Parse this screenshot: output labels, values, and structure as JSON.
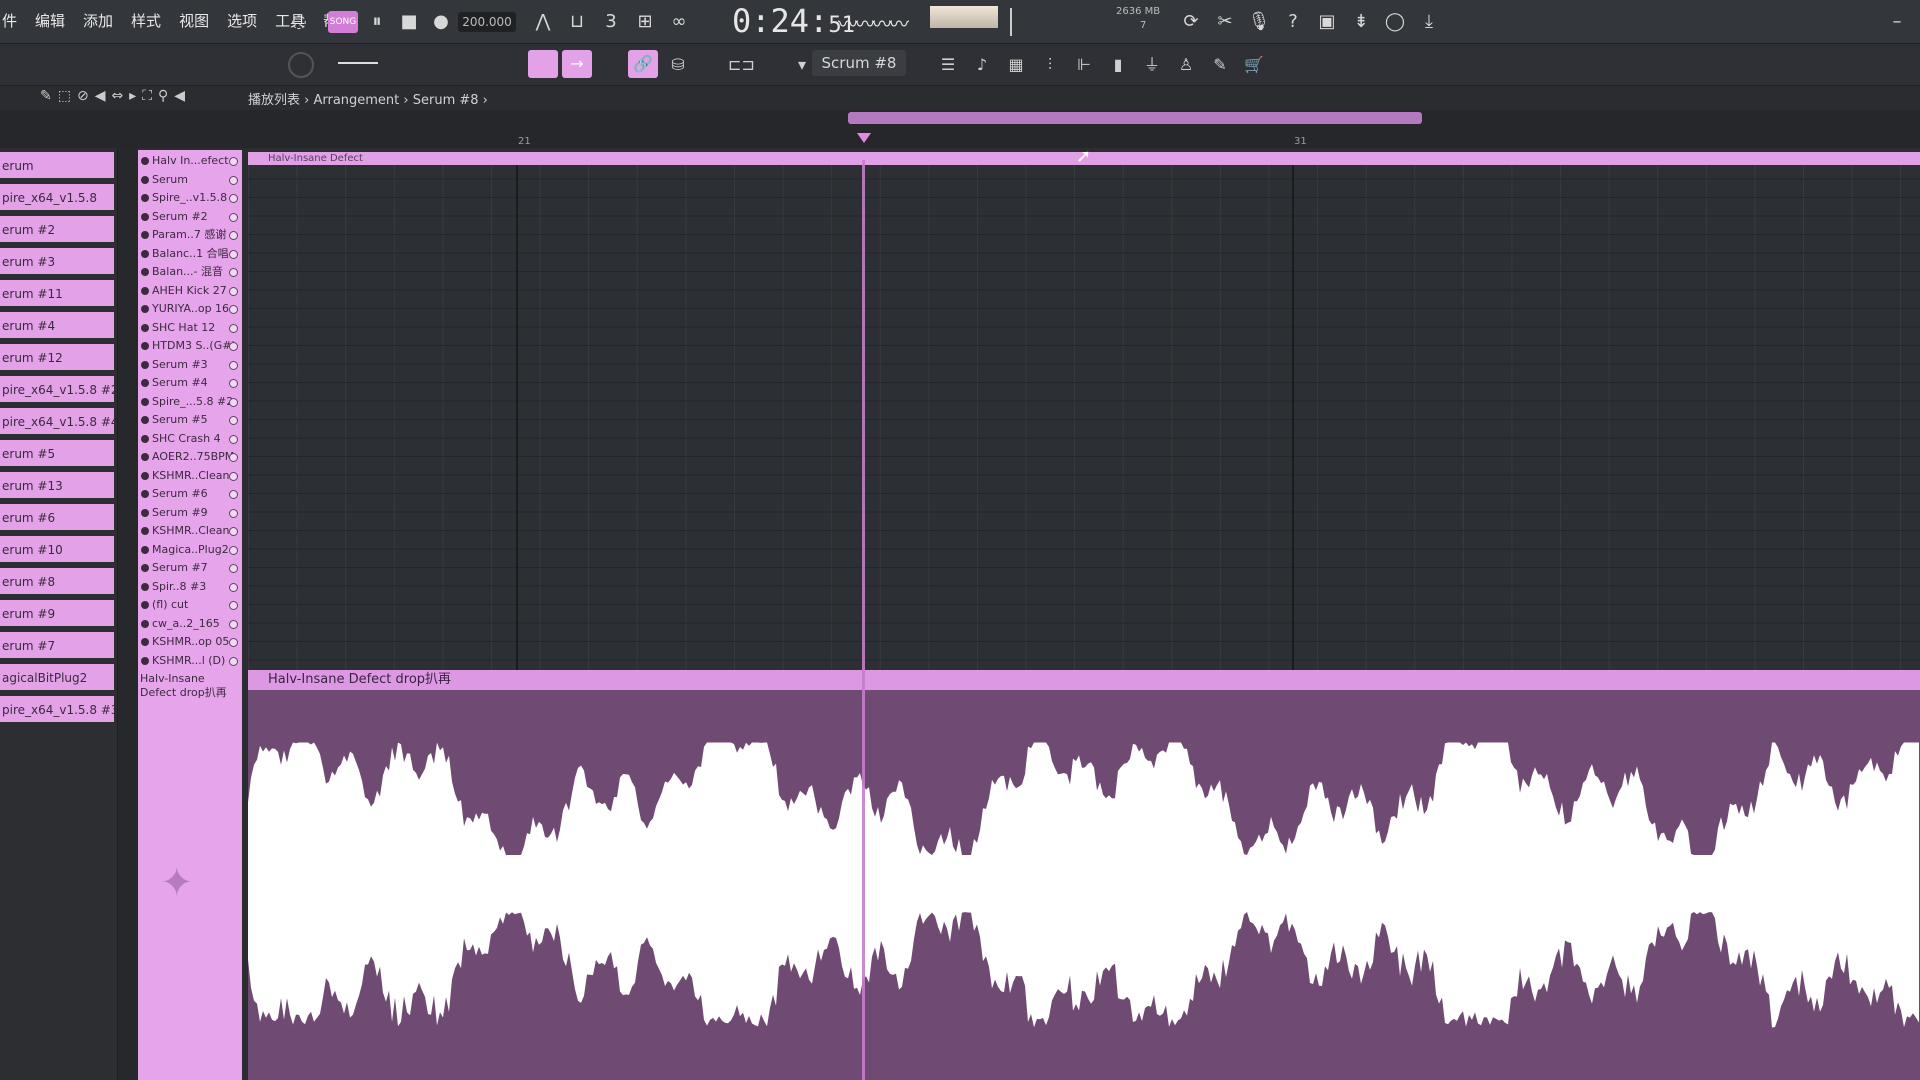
{
  "menu": [
    "件",
    "编辑",
    "添加",
    "样式",
    "视图",
    "选项",
    "工具",
    "帮助"
  ],
  "transport": {
    "pat_label": "SONG",
    "tempo": "200.000",
    "time": "0:24:",
    "time_small": "51"
  },
  "info": {
    "mem": "2636 MB",
    "cpu": "7"
  },
  "toolbar2": {
    "pattern": "Scrum #8"
  },
  "breadcrumb": {
    "text": "播放列表 › Arrangement › Serum #8 ›"
  },
  "ruler": {
    "n1": "21",
    "n2": "31"
  },
  "browser_items": [
    "erum",
    "pire_x64_v1.5.8",
    "erum #2",
    "erum #3",
    "erum #11",
    "erum #4",
    "erum #12",
    "pire_x64_v1.5.8 #2",
    "pire_x64_v1.5.8 #4",
    "erum #5",
    "erum #13",
    "erum #6",
    "erum #10",
    "erum #8",
    "erum #9",
    "erum #7",
    "agicalBitPlug2",
    "pire_x64_v1.5.8 #3"
  ],
  "tracks": [
    "Halv In...efect",
    "Serum",
    "Spire_..v1.5.8",
    "Serum #2",
    "Param..7 感谢",
    "Balanc..1 合唱",
    "Balan...- 混音",
    "AHEH Kick 27",
    "YURIYA..op 16",
    "SHC Hat 12",
    "HTDM3 S..(G#)",
    "Serum #3",
    "Serum #4",
    "Spire_...5.8 #2",
    "Serum #5",
    "SHC Crash 4",
    "AOER2..75BPM",
    "KSHMR..Clean",
    "Serum #6",
    "Serum #9",
    "KSHMR..Clean",
    "Magica..Plug2",
    "Serum #7",
    "Spir..8 #3",
    "(fl) cut",
    "cw_a..2_165",
    "KSHMR..op 05",
    "KSHMR...l (D)"
  ],
  "audio_track": "Halv-Insane Defect drop扒再",
  "pattern_strip": "Halv-Insane Defect",
  "clip_title": "Halv-Insane Defect drop扒再",
  "colors": {
    "accent": "#e3a2e8",
    "clip_body": "#6f4a72",
    "waveform": "#ffffff"
  }
}
